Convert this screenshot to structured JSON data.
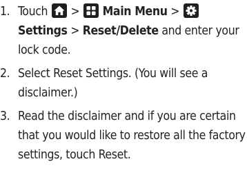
{
  "steps": [
    {
      "num": "1.",
      "touch": "Touch",
      "sep1": ">",
      "home_icon": "home-icon",
      "menu_icon": "grid-menu-icon",
      "main_menu": "Main Menu",
      "sep2": ">",
      "settings_icon": "gear-icon",
      "sep3": ">",
      "settings": "Settings",
      "reset_delete": "Reset/Delete",
      "tail": "and enter your lock code."
    },
    {
      "num": "2.",
      "text": "Select Reset Settings. (You will see a disclaimer.)"
    },
    {
      "num": "3.",
      "text": "Read the disclaimer and if you are certain that you would like to restore all the factory settings, touch Reset."
    }
  ],
  "colors": {
    "text": "#222222",
    "icon_bg": "#1f1f1f",
    "icon_fg": "#ffffff"
  }
}
